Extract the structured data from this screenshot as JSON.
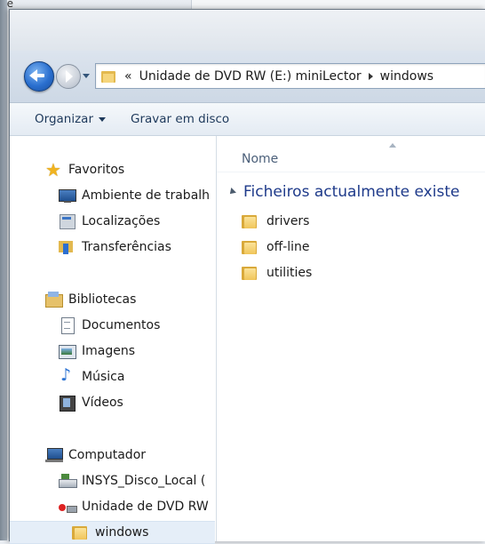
{
  "background_window": {
    "title_fragment": "de",
    "right_fragment": ""
  },
  "address_bar": {
    "overflow": "«",
    "segments": [
      "Unidade de DVD RW (E:) miniLector",
      "windows"
    ]
  },
  "toolbar": {
    "organize": "Organizar",
    "burn": "Gravar em disco"
  },
  "nav": {
    "favorites": {
      "label": "Favoritos",
      "icon": "star-icon",
      "items": [
        {
          "label": "Ambiente de trabalh",
          "icon": "desktop-icon"
        },
        {
          "label": "Localizações",
          "icon": "recent-places-icon"
        },
        {
          "label": "Transferências",
          "icon": "downloads-icon"
        }
      ]
    },
    "libraries": {
      "label": "Bibliotecas",
      "icon": "libraries-icon",
      "items": [
        {
          "label": "Documentos",
          "icon": "documents-icon"
        },
        {
          "label": "Imagens",
          "icon": "pictures-icon"
        },
        {
          "label": "Música",
          "icon": "music-icon"
        },
        {
          "label": "Vídeos",
          "icon": "videos-icon"
        }
      ]
    },
    "computer": {
      "label": "Computador",
      "icon": "computer-icon",
      "items": [
        {
          "label": "INSYS_Disco_Local (",
          "icon": "local-disk-icon"
        },
        {
          "label": "Unidade de DVD RW",
          "icon": "dvd-drive-icon"
        },
        {
          "label": "windows",
          "icon": "folder-icon",
          "selected": true
        }
      ]
    }
  },
  "content": {
    "column_name": "Nome",
    "group_label": "Ficheiros actualmente existe",
    "files": [
      {
        "name": "drivers",
        "icon": "folder-icon"
      },
      {
        "name": "off-line",
        "icon": "folder-icon"
      },
      {
        "name": "utilities",
        "icon": "folder-icon"
      }
    ]
  },
  "colors": {
    "selection": "#e5eef8",
    "group_header": "#1e3a8a",
    "command_text": "#1e395b"
  }
}
